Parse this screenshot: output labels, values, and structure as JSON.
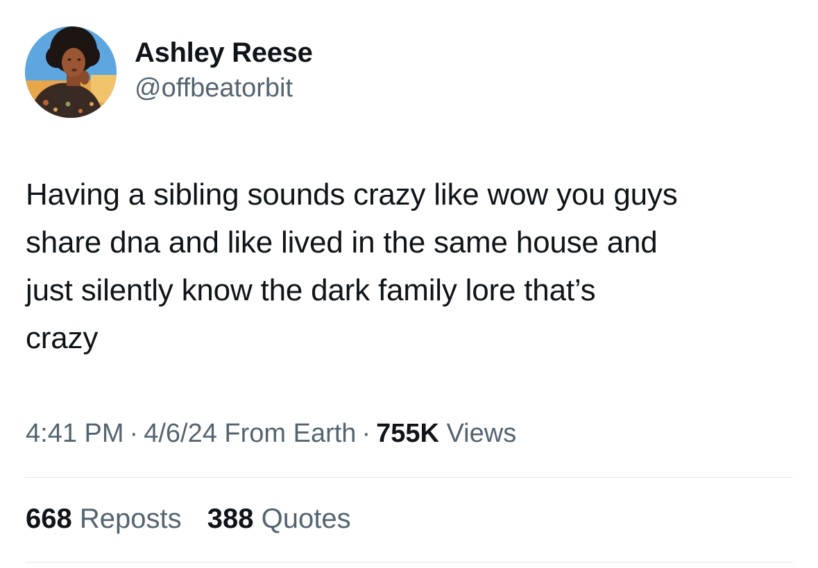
{
  "author": {
    "display_name": "Ashley Reese",
    "handle": "@offbeatorbit",
    "avatar_icon": "profile-photo"
  },
  "tweet": {
    "text_lines": [
      "Having a sibling sounds crazy like wow you guys",
      "share dna and like lived in the same house and",
      "just silently know the dark family lore that’s",
      "crazy"
    ]
  },
  "meta": {
    "time": "4:41 PM",
    "separator": "·",
    "date": "4/6/24",
    "source": "From Earth",
    "views_count": "755K",
    "views_label": "Views"
  },
  "stats": {
    "reposts_count": "668",
    "reposts_label": "Reposts",
    "quotes_count": "388",
    "quotes_label": "Quotes"
  },
  "colors": {
    "text_primary": "#0f1419",
    "text_secondary": "#536471",
    "divider": "#e1e6ea"
  }
}
